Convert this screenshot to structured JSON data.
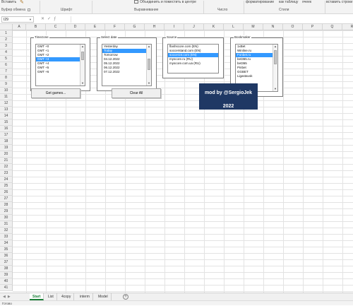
{
  "ribbon": {
    "top_labels": [
      "Вставить",
      "форматирование",
      "как таблицу",
      "ячеек",
      "вставить строки"
    ],
    "groups": [
      "Буфер обмена",
      "Шрифт",
      "Выравнивание",
      "Число",
      "Стили"
    ],
    "merge_label": "Объединить и поместить в центре"
  },
  "formula_bar": {
    "name_box": "I29",
    "formula": ""
  },
  "columns": [
    "A",
    "B",
    "C",
    "D",
    "E",
    "F",
    "G",
    "H",
    "I",
    "J",
    "K",
    "L",
    "M",
    "N",
    "O",
    "P",
    "Q",
    "R"
  ],
  "rows": [
    "1",
    "2",
    "3",
    "4",
    "5",
    "6",
    "7",
    "8",
    "9",
    "10",
    "11",
    "12",
    "13",
    "14",
    "15",
    "16",
    "17",
    "18",
    "19",
    "20",
    "21",
    "22",
    "23",
    "24",
    "25",
    "26",
    "27",
    "28",
    "29",
    "30",
    "31",
    "32",
    "33",
    "34",
    "35",
    "36",
    "37",
    "38",
    "39",
    "40",
    "41"
  ],
  "controls": {
    "timezone": {
      "legend": "Timezone",
      "items": [
        "GMT +0",
        "GMT +1",
        "GMT +2",
        "GMT +3",
        "GMT +4",
        "GMT +5",
        "GMT +6"
      ],
      "selected_index": 3
    },
    "date": {
      "legend": "Select date",
      "items": [
        "Yesterday",
        "Today",
        "Tomorrow",
        "04.12.2022",
        "05.12.2022",
        "06.12.2022",
        "07.12.2022"
      ],
      "selected_index": 1
    },
    "source": {
      "legend": "Source",
      "items": [
        "flashscore.com (EN)",
        "soccerstand.com (EN)",
        "soccer24.com (EN)",
        "myscore.ru (RU)",
        "myscore.com.ua (RU)"
      ],
      "selected_index": 2
    },
    "bookmaker": {
      "legend": "Bookmaker",
      "items": [
        "1xBet",
        "Winline.ru",
        "Fonbet.ru",
        "bet365.ru",
        "bet365",
        "Pinbet",
        "GGBET",
        "Ligastavok"
      ],
      "selected_index": 2
    },
    "get_games_label": "Get games...",
    "clear_all_label": "Clear All"
  },
  "banner": {
    "line1": "mod by @SergioJek",
    "line2": "2022",
    "color": "#1f3864"
  },
  "tabs": [
    "Start",
    "List",
    "4copy",
    "interm",
    "Model"
  ],
  "active_tab": "Start",
  "status": "Готово"
}
